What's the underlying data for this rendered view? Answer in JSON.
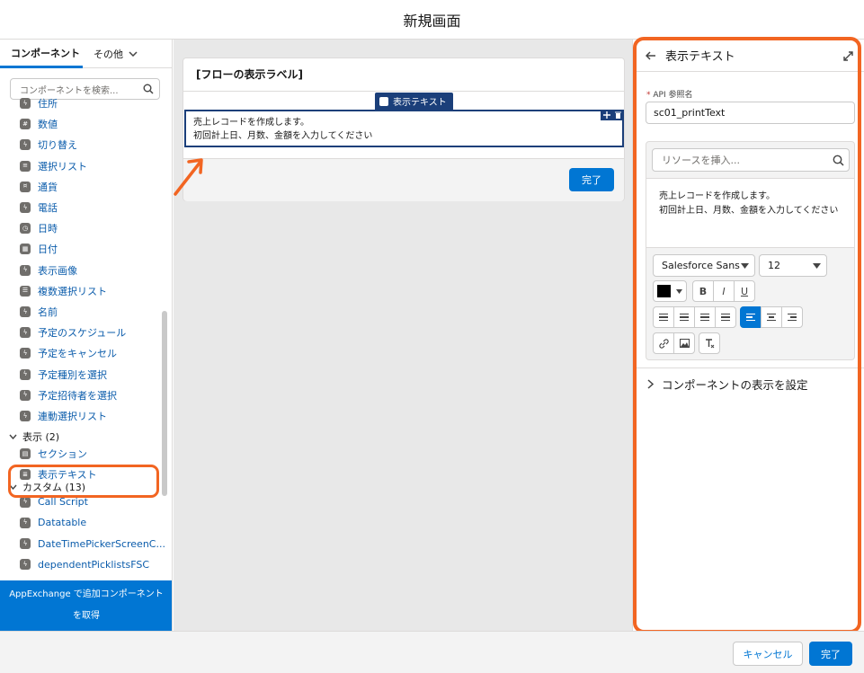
{
  "header": {
    "title": "新規画面"
  },
  "left": {
    "tabs": [
      "コンポーネント",
      "その他"
    ],
    "search_placeholder": "コンポーネントを検索...",
    "items_top": [
      {
        "label": "住所",
        "icon": "bolt-icon"
      },
      {
        "label": "数値",
        "icon": "number-icon"
      },
      {
        "label": "切り替え",
        "icon": "bolt-icon"
      },
      {
        "label": "選択リスト",
        "icon": "list-icon"
      },
      {
        "label": "通貨",
        "icon": "currency-icon"
      },
      {
        "label": "電話",
        "icon": "bolt-icon"
      },
      {
        "label": "日時",
        "icon": "clock-icon"
      },
      {
        "label": "日付",
        "icon": "calendar-icon"
      },
      {
        "label": "表示画像",
        "icon": "bolt-icon"
      },
      {
        "label": "複数選択リスト",
        "icon": "multi-list-icon"
      },
      {
        "label": "名前",
        "icon": "bolt-icon"
      },
      {
        "label": "予定のスケジュール",
        "icon": "bolt-icon"
      },
      {
        "label": "予定をキャンセル",
        "icon": "bolt-icon"
      },
      {
        "label": "予定種別を選択",
        "icon": "bolt-icon"
      },
      {
        "label": "予定招待者を選択",
        "icon": "bolt-icon"
      },
      {
        "label": "連動選択リスト",
        "icon": "bolt-icon"
      }
    ],
    "display_section": "表示 (2)",
    "display_items": [
      {
        "label": "セクション",
        "icon": "section-icon"
      },
      {
        "label": "表示テキスト",
        "icon": "text-icon"
      }
    ],
    "custom_section": "カスタム (13)",
    "custom_items": [
      {
        "label": "Call Script",
        "icon": "bolt-icon"
      },
      {
        "label": "Datatable",
        "icon": "bolt-icon"
      },
      {
        "label": "DateTimePickerScreenC...",
        "icon": "bolt-icon"
      },
      {
        "label": "dependentPicklistsFSC",
        "icon": "bolt-icon"
      }
    ],
    "appexchange": "AppExchange で追加コンポーネントを取得"
  },
  "canvas": {
    "card_title": "[フローの表示ラベル]",
    "chip_label": "表示テキスト",
    "text_line1": "売上レコードを作成します。",
    "text_line2": "初回計上日、月数、金額を入力してください",
    "done": "完了"
  },
  "right": {
    "title": "表示テキスト",
    "api_label": "API 参照名",
    "api_value": "sc01_printText",
    "resource_placeholder": "リソースを挿入...",
    "editor_text": "売上レコードを作成します。\n初回計上日、月数、金額を入力してください",
    "font": "Salesforce Sans",
    "size": "12",
    "text_color": "#000000",
    "section": "コンポーネントの表示を設定"
  },
  "footer": {
    "cancel": "キャンセル",
    "finish": "完了"
  },
  "colors": {
    "brand": "#0176d3",
    "chip": "#1b3f7a",
    "highlight": "#f26522"
  }
}
